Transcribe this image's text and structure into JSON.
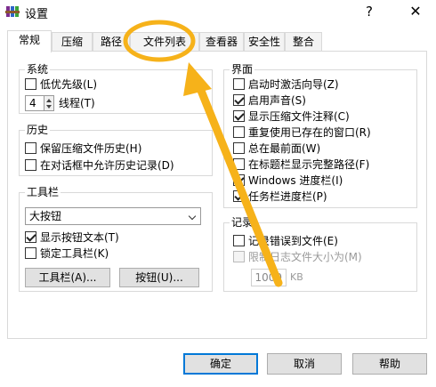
{
  "window": {
    "title": "设置",
    "help_label": "?",
    "close_label": "✕"
  },
  "tabs": [
    {
      "label": "常规"
    },
    {
      "label": "压缩"
    },
    {
      "label": "路径"
    },
    {
      "label": "文件列表"
    },
    {
      "label": "查看器"
    },
    {
      "label": "安全性"
    },
    {
      "label": "整合"
    }
  ],
  "system": {
    "title": "系统",
    "low_priority": "低优先级(L)",
    "threads_value": "4",
    "threads_label": "线程(T)"
  },
  "history": {
    "title": "历史",
    "keep_history": "保留压缩文件历史(H)",
    "allow_dialog_history": "在对话框中允许历史记录(D)"
  },
  "toolbar": {
    "title": "工具栏",
    "style_selected": "大按钮",
    "show_text": "显示按钮文本(T)",
    "lock_toolbar": "锁定工具栏(K)",
    "toolbar_button": "工具栏(A)...",
    "buttons_button": "按钮(U)..."
  },
  "interface": {
    "title": "界面",
    "items": [
      {
        "label": "启动时激活向导(Z)",
        "checked": false
      },
      {
        "label": "启用声音(S)",
        "checked": true
      },
      {
        "label": "显示压缩文件注释(C)",
        "checked": true
      },
      {
        "label": "重复使用已存在的窗口(R)",
        "checked": false
      },
      {
        "label": "总在最前面(W)",
        "checked": false
      },
      {
        "label": "在标题栏显示完整路径(F)",
        "checked": false
      },
      {
        "label": "Windows 进度栏(I)",
        "checked": true
      },
      {
        "label": "任务栏进度栏(P)",
        "checked": true
      }
    ]
  },
  "log": {
    "title": "记录",
    "log_errors": "记录错误到文件(E)",
    "limit_size": "限制日志文件大小为(M)",
    "size_value": "1000",
    "size_unit": "KB"
  },
  "footer": {
    "ok": "确定",
    "cancel": "取消",
    "help": "帮助"
  },
  "annotation": {
    "color": "#f6b21a"
  }
}
